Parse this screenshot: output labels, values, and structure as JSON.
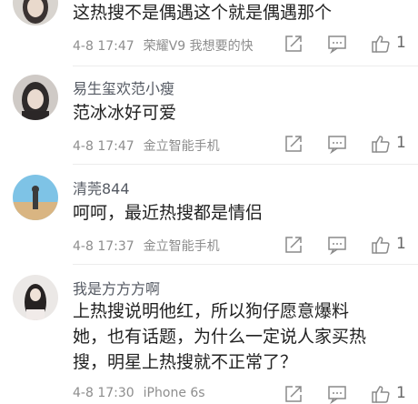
{
  "comments": [
    {
      "username": "",
      "text_lines": [
        "这热搜不是偶遇这个就是偶遇那个"
      ],
      "date": "4-8 17:47",
      "device": "荣耀V9 我想要的快",
      "likes": "1"
    },
    {
      "username": "易生玺欢范小瘦",
      "text_lines": [
        "范冰冰好可爱"
      ],
      "date": "4-8 17:47",
      "device": "金立智能手机",
      "likes": "1"
    },
    {
      "username": "清莞844",
      "text_lines": [
        "呵呵，最近热搜都是情侣"
      ],
      "date": "4-8 17:37",
      "device": "金立智能手机",
      "likes": "1"
    },
    {
      "username": "我是方方方啊",
      "text_lines": [
        "上热搜说明他红，所以狗仔愿意爆料",
        "她，也有话题，为什么一定说人家买热",
        "搜，明星上热搜就不正常了？"
      ],
      "date": "4-8 17:30",
      "device": "iPhone 6s",
      "likes": "1"
    }
  ],
  "icons": [
    "repost-icon",
    "reply-icon",
    "like-icon"
  ],
  "colors": {
    "meta": "#8d8d8d",
    "icon": "#8a8a8a"
  }
}
